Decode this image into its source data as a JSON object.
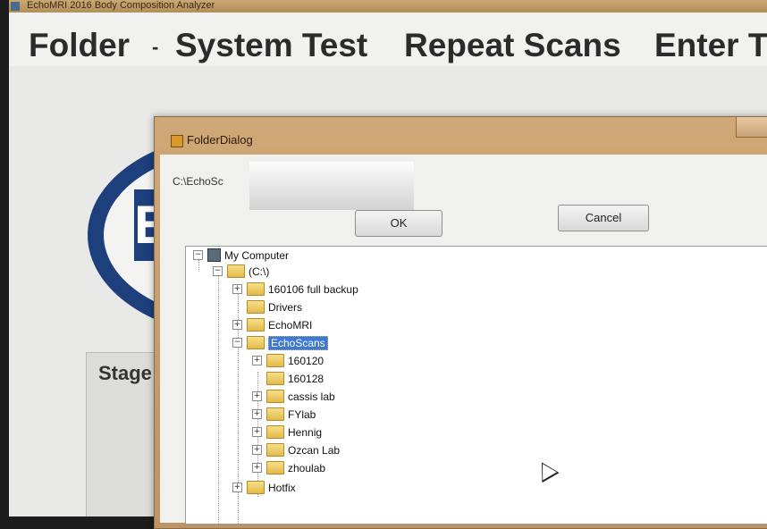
{
  "app": {
    "title": "EchoMRI 2016 Body Composition Analyzer",
    "menu": [
      "Folder",
      "System Test",
      "Repeat Scans",
      "Enter T"
    ],
    "menu_separator": "-",
    "stage_label": "Stage",
    "logo_letter": "E"
  },
  "dialog": {
    "title": "FolderDialog",
    "path_value": "C:\\EchoSc",
    "ok_label": "OK",
    "cancel_label": "Cancel",
    "tree": [
      {
        "label": "My Computer",
        "icon": "computer-icon",
        "expander": "minus"
      },
      {
        "label": "(C:\\)",
        "icon": "drive-folder-icon",
        "expander": "minus"
      },
      {
        "label": "160106 full backup",
        "icon": "folder-icon",
        "expander": "plus"
      },
      {
        "label": "Drivers",
        "icon": "folder-icon",
        "expander": "none"
      },
      {
        "label": "EchoMRI",
        "icon": "folder-icon",
        "expander": "plus"
      },
      {
        "label": "EchoScans",
        "icon": "folder-open-icon",
        "expander": "minus",
        "selected": true
      },
      {
        "label": "160120",
        "icon": "folder-icon",
        "expander": "plus"
      },
      {
        "label": "160128",
        "icon": "folder-icon",
        "expander": "none"
      },
      {
        "label": "cassis lab",
        "icon": "folder-icon",
        "expander": "plus"
      },
      {
        "label": "FYlab",
        "icon": "folder-icon",
        "expander": "plus"
      },
      {
        "label": "Hennig",
        "icon": "folder-icon",
        "expander": "plus"
      },
      {
        "label": "Ozcan Lab",
        "icon": "folder-icon",
        "expander": "plus"
      },
      {
        "label": "zhoulab",
        "icon": "folder-icon",
        "expander": "plus"
      },
      {
        "label": "Hotfix",
        "icon": "folder-icon",
        "expander": "plus"
      }
    ],
    "selection_color": "#3b79d4"
  }
}
